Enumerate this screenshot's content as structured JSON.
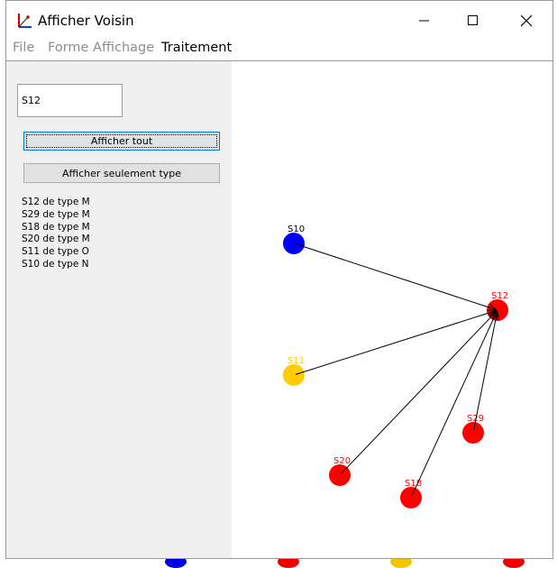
{
  "window": {
    "title": "Afficher Voisin",
    "controls": {
      "minimize": "minimize",
      "maximize": "maximize",
      "close": "close"
    }
  },
  "menu": {
    "items": [
      {
        "label": "File",
        "enabled": false
      },
      {
        "label": "Forme Affichage",
        "enabled": false
      },
      {
        "label": "Traitement",
        "enabled": true
      }
    ]
  },
  "panel": {
    "search_value": "S12",
    "btn_all": "Afficher tout",
    "btn_type": "Afficher seulement type",
    "results": [
      "S12 de type M",
      "S29 de type M",
      "S18 de type M",
      "S20 de type M",
      "S11 de type O",
      "S10 de type N"
    ]
  },
  "graph": {
    "nodes": [
      {
        "id": "S10",
        "label": "S10",
        "color": "#0000ff",
        "label_color": "#000000"
      },
      {
        "id": "S12",
        "label": "S12",
        "color": "#ff0000",
        "label_color": "#ff0000"
      },
      {
        "id": "S11",
        "label": "S11",
        "color": "#ffcc00",
        "label_color": "#ffcc00"
      },
      {
        "id": "S29",
        "label": "S29",
        "color": "#ff0000",
        "label_color": "#ff0000"
      },
      {
        "id": "S20",
        "label": "S20",
        "color": "#ff0000",
        "label_color": "#ff0000"
      },
      {
        "id": "S18",
        "label": "S18",
        "color": "#ff0000",
        "label_color": "#ff0000"
      }
    ],
    "edges": [
      {
        "from": "S10",
        "to": "S12"
      },
      {
        "from": "S11",
        "to": "S12"
      },
      {
        "from": "S20",
        "to": "S12"
      },
      {
        "from": "S18",
        "to": "S12"
      },
      {
        "from": "S29",
        "to": "S12"
      }
    ]
  }
}
